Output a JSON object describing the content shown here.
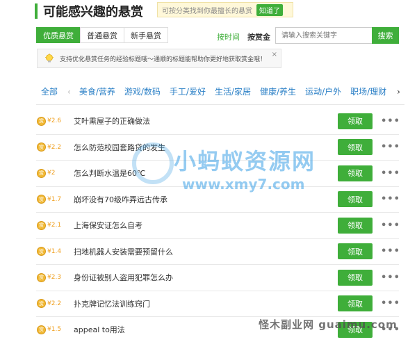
{
  "header": {
    "title": "可能感兴趣的悬赏",
    "hint": "可按分类找到你最擅长的悬赏",
    "hint_ok": "知道了"
  },
  "tabs": [
    {
      "label": "优质悬赏",
      "active": true
    },
    {
      "label": "普通悬赏",
      "active": false
    },
    {
      "label": "新手悬赏",
      "active": false
    }
  ],
  "sort": {
    "by_time": "按时间",
    "by_reward": "按赏金"
  },
  "search": {
    "placeholder": "请输入搜索关键字",
    "button": "搜索"
  },
  "tip": {
    "text": "支持优化悬赏任务的经验标题哦～通顺的标题能帮助你更好地获取赏金哦！",
    "close": "×"
  },
  "categories": {
    "all": "全部",
    "items": [
      "美食/营养",
      "游戏/数码",
      "手工/爱好",
      "生活/家居",
      "健康/养生",
      "运动/户外",
      "职场/理财"
    ],
    "left_arrow": "‹",
    "right_arrow": "›"
  },
  "questions": [
    {
      "reward": "¥2.6",
      "title": "艾叶熏屋子的正确做法",
      "button": "领取"
    },
    {
      "reward": "¥2.2",
      "title": "怎么防范校园套路贷的发生",
      "button": "领取"
    },
    {
      "reward": "¥2",
      "title": "怎么判断水温是60℃",
      "button": "领取"
    },
    {
      "reward": "¥1.7",
      "title": "崩坏没有70级咋弄远古传承",
      "button": "领取"
    },
    {
      "reward": "¥2.1",
      "title": "上海保安证怎么自考",
      "button": "领取"
    },
    {
      "reward": "¥1.4",
      "title": "扫地机器人安装需要预留什么",
      "button": "领取"
    },
    {
      "reward": "¥2.3",
      "title": "身份证被别人盗用犯罪怎么办",
      "button": "领取"
    },
    {
      "reward": "¥2.2",
      "title": "扑克牌记忆法训练窍门",
      "button": "领取"
    },
    {
      "reward": "¥1.5",
      "title": "appeal to用法",
      "button": "领取"
    }
  ],
  "more_symbol": "•••",
  "coin_symbol": "赏",
  "watermark": {
    "name": "小蚂蚁资源网",
    "url": "www.xmy7.com"
  },
  "footer_mark": "怪木副业网 guaimu.com",
  "colors": {
    "accent": "#3fae3a",
    "link": "#2a7fc6",
    "reward": "#f0a020"
  }
}
